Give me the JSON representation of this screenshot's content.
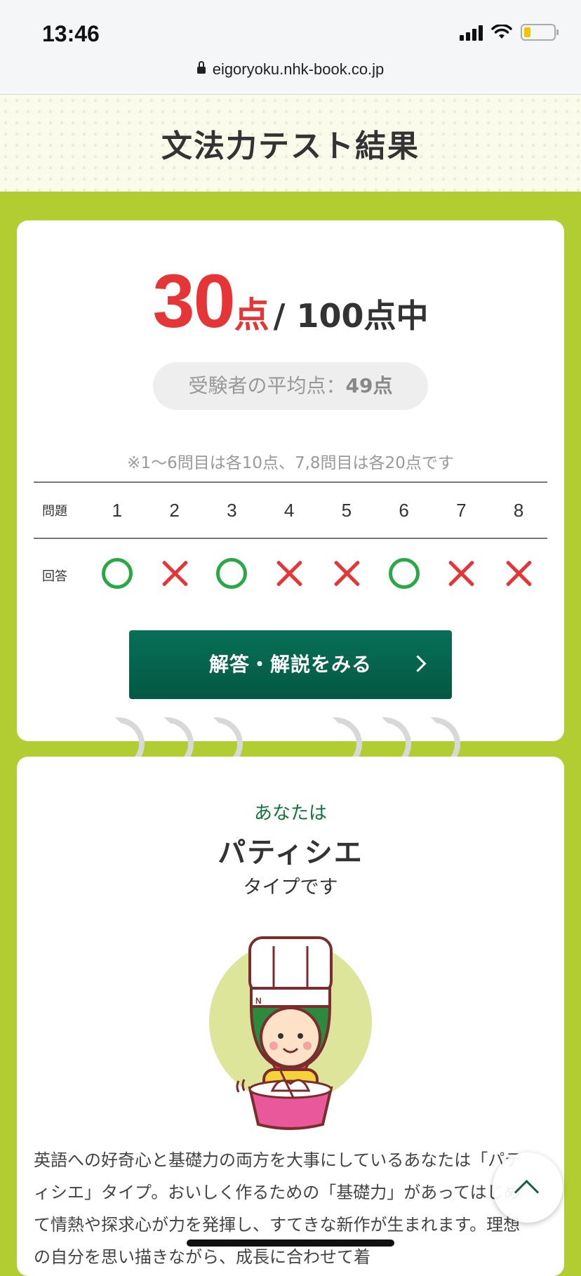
{
  "status_bar": {
    "time": "13:46"
  },
  "browser": {
    "url": "eigoryoku.nhk-book.co.jp"
  },
  "page": {
    "title": "文法力テスト結果"
  },
  "score": {
    "value": "30",
    "unit": "点",
    "total": "/ 100点中",
    "average_label": "受験者の平均点：",
    "average_value": "49点",
    "note": "※1〜6問目は各10点、7,8問目は各20点です"
  },
  "results_table": {
    "question_label": "問題",
    "answer_label": "回答",
    "questions": [
      "1",
      "2",
      "3",
      "4",
      "5",
      "6",
      "7",
      "8"
    ],
    "answers": [
      "correct",
      "incorrect",
      "correct",
      "incorrect",
      "incorrect",
      "correct",
      "incorrect",
      "incorrect"
    ]
  },
  "answer_button": {
    "label": "解答・解説をみる"
  },
  "type_result": {
    "lead": "あなたは",
    "name": "パティシエ",
    "tail": "タイプです",
    "description": "英語への好奇心と基礎力の両方を大事にしているあなたは「パティシエ」タイプ。おいしく作るための「基礎力」があってはじめて情熱や探求心が力を発揮し、すてきな新作が生まれます。理想の自分を思い描きながら、成長に合わせて着"
  },
  "colors": {
    "page_bg": "#b2cd31",
    "score_red": "#e53536",
    "correct_green": "#2aa845",
    "button_green": "#076a52"
  },
  "icons": [
    "lock-icon",
    "signal-icon",
    "wifi-icon",
    "battery-icon",
    "chevron-right-icon",
    "chevron-up-icon",
    "circle-mark-icon",
    "cross-mark-icon"
  ]
}
